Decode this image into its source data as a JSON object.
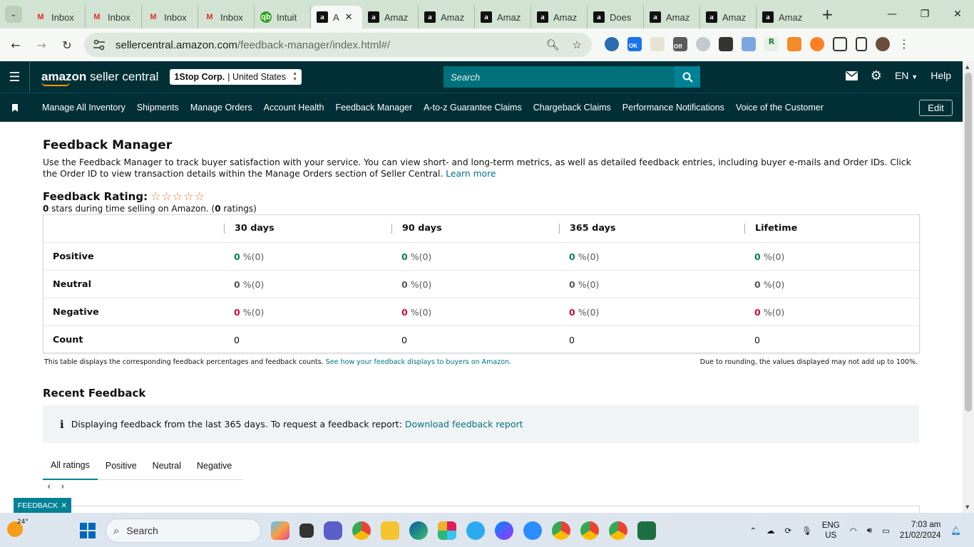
{
  "browser": {
    "tabs": [
      {
        "label": "Inbox",
        "favicon": "gmail"
      },
      {
        "label": "Inbox",
        "favicon": "gmail"
      },
      {
        "label": "Inbox",
        "favicon": "gmail"
      },
      {
        "label": "Inbox",
        "favicon": "gmail"
      },
      {
        "label": "Intuit",
        "favicon": "intuit"
      },
      {
        "label": "A",
        "favicon": "amazon",
        "active": true
      },
      {
        "label": "Amaz",
        "favicon": "amazon"
      },
      {
        "label": "Amaz",
        "favicon": "amazon"
      },
      {
        "label": "Amaz",
        "favicon": "amazon"
      },
      {
        "label": "Amaz",
        "favicon": "amazon"
      },
      {
        "label": "Does",
        "favicon": "amazon"
      },
      {
        "label": "Amaz",
        "favicon": "amazon"
      },
      {
        "label": "Amaz",
        "favicon": "amazon"
      },
      {
        "label": "Amaz",
        "favicon": "amazon"
      }
    ],
    "url_host": "sellercentral.amazon.com",
    "url_path": "/feedback-manager/index.html#/",
    "ext_badge_ok": "OK",
    "ext_badge_off": "Off"
  },
  "header": {
    "logo_bold": "amazon",
    "logo_rest": " seller central",
    "account_name": "1Stop Corp.",
    "account_region": "| United States",
    "search_placeholder": "Search",
    "language": "EN",
    "help": "Help"
  },
  "nav": {
    "items": [
      "Manage All Inventory",
      "Shipments",
      "Manage Orders",
      "Account Health",
      "Feedback Manager",
      "A-to-z Guarantee Claims",
      "Chargeback Claims",
      "Performance Notifications",
      "Voice of the Customer"
    ],
    "edit": "Edit"
  },
  "page": {
    "title": "Feedback Manager",
    "intro": "Use the Feedback Manager to track buyer satisfaction with your service. You can view short- and long-term metrics, as well as detailed feedback entries, including buyer e-mails and Order IDs. Click the Order ID to view transaction details within the Manage Orders section of Seller Central.",
    "learn_more": "Learn more",
    "rating_label": "Feedback Rating:",
    "stars": "☆☆☆☆☆",
    "stars_value": 0,
    "rating_stars": "0",
    "rating_mid": " stars during time selling on Amazon. (",
    "rating_count": "0",
    "rating_end": " ratings)"
  },
  "table": {
    "columns": [
      "30 days",
      "90 days",
      "365 days",
      "Lifetime"
    ],
    "pct_suffix": "%(0)",
    "rows": [
      {
        "label": "Positive",
        "values": [
          "0",
          "0",
          "0",
          "0"
        ]
      },
      {
        "label": "Neutral",
        "values": [
          "0",
          "0",
          "0",
          "0"
        ]
      },
      {
        "label": "Negative",
        "values": [
          "0",
          "0",
          "0",
          "0"
        ]
      },
      {
        "label": "Count",
        "values": [
          "0",
          "0",
          "0",
          "0"
        ]
      }
    ],
    "footnote": "This table displays the corresponding feedback percentages and feedback counts.",
    "footnote_link": "See how your feedback displays to buyers on Amazon",
    "footnote_right": "Due to rounding, the values displayed may not add up to 100%."
  },
  "recent": {
    "title": "Recent Feedback",
    "info_text": "Displaying feedback from the last 365 days. To request a feedback report:",
    "info_link": "Download feedback report",
    "tabs": [
      "All ratings",
      "Positive",
      "Neutral",
      "Negative"
    ]
  },
  "feedback_tab": "FEEDBACK",
  "taskbar": {
    "temperature": "24°",
    "search": "Search",
    "language": "ENG",
    "region": "US",
    "time": "7:03 am",
    "date": "21/02/2024"
  },
  "colors": {
    "header_bg": "#002f36",
    "search_bg": "#00707a",
    "positive": "#067d62",
    "negative": "#cc0c39",
    "link": "#007185"
  }
}
